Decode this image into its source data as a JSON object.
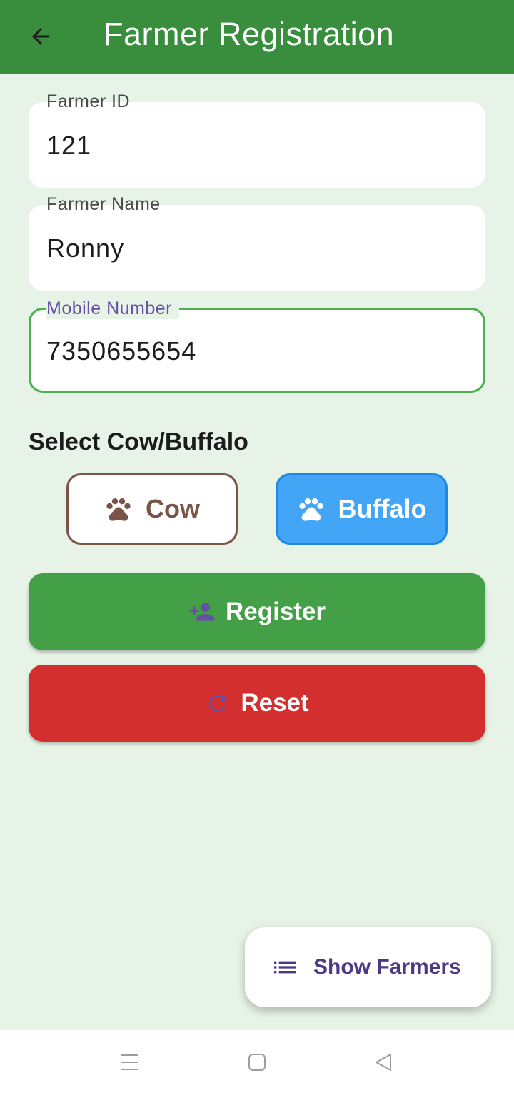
{
  "app_bar": {
    "title": "Farmer Registration",
    "back_icon": "arrow-back-icon",
    "background": "#388e3c"
  },
  "form": {
    "farmer_id": {
      "label": "Farmer ID",
      "value": "121"
    },
    "farmer_name": {
      "label": "Farmer Name",
      "value": "Ronny"
    },
    "mobile_number": {
      "label": "Mobile Number",
      "value": "7350655654",
      "focused": true
    }
  },
  "animal_selection": {
    "title": "Select Cow/Buffalo",
    "options": [
      {
        "label": "Cow",
        "icon": "paw-icon",
        "selected": false,
        "color": "#795548"
      },
      {
        "label": "Buffalo",
        "icon": "paw-icon",
        "selected": true,
        "color": "#42a5f5"
      }
    ]
  },
  "actions": {
    "register": {
      "label": "Register",
      "icon": "person-add-icon",
      "color": "#43a047"
    },
    "reset": {
      "label": "Reset",
      "icon": "refresh-icon",
      "color": "#d32f2f"
    }
  },
  "fab": {
    "label": "Show Farmers",
    "icon": "list-icon"
  },
  "system_nav": {
    "items": [
      "menu-icon",
      "home-square-icon",
      "back-triangle-icon"
    ]
  },
  "colors": {
    "page_background": "#e6f3e6",
    "accent_purple": "#6750a4",
    "focus_green": "#4caf50"
  }
}
